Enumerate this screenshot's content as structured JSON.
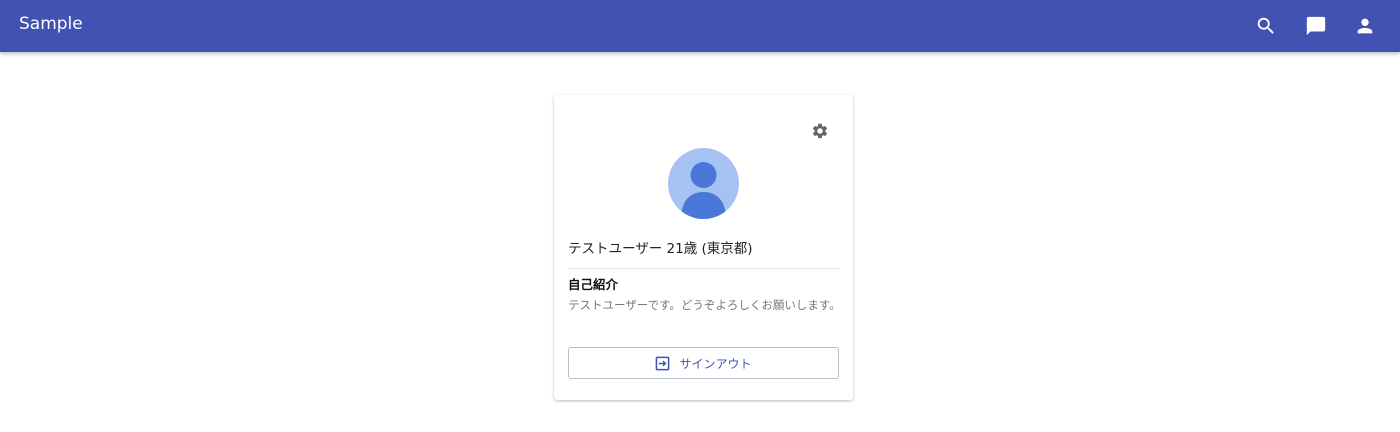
{
  "appbar": {
    "title": "Sample",
    "icons": [
      "search-icon",
      "chat-icon",
      "account-icon"
    ],
    "color": "#4252b3"
  },
  "profile": {
    "settings_icon": "gear-icon",
    "avatar_icon": "person-icon",
    "name_line": "テストユーザー 21歳 (東京都)",
    "section_title": "自己紹介",
    "bio": "テストユーザーです。どうぞよろしくお願いします。",
    "signout_icon": "signout-icon",
    "signout_label": "サインアウト"
  }
}
